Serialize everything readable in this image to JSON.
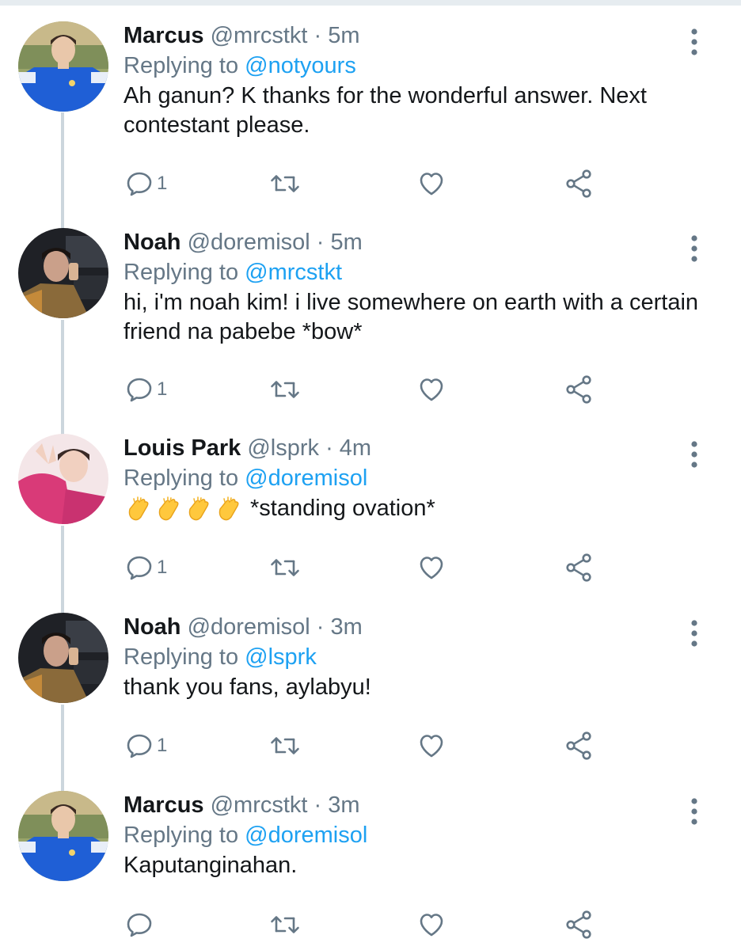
{
  "colors": {
    "accent": "#1da1f2",
    "muted": "#657786",
    "text": "#14171a",
    "line": "#ccd6dd"
  },
  "icons": {
    "reply": "reply-icon",
    "retweet": "retweet-icon",
    "like": "heart-icon",
    "share": "share-icon",
    "more": "more-vertical-icon",
    "clap": "clapping-hands-emoji"
  },
  "tweets": [
    {
      "name": "Marcus",
      "handle": "@mrcstkt",
      "sep": " · ",
      "time": "5m",
      "replying_prefix": "Replying to ",
      "replying_to": "@notyours",
      "text": "Ah ganun? K thanks for the wonderful answer. Next contestant please.",
      "reply_count": "1"
    },
    {
      "name": "Noah",
      "handle": "@doremisol",
      "sep": " · ",
      "time": "5m",
      "replying_prefix": "Replying to ",
      "replying_to": "@mrcstkt",
      "text": "hi, i'm noah kim! i live somewhere on earth with a certain friend na pabebe *bow*",
      "reply_count": "1"
    },
    {
      "name": "Louis Park",
      "handle": "@lsprk",
      "sep": " · ",
      "time": "4m",
      "replying_prefix": "Replying to ",
      "replying_to": "@doremisol",
      "text": "*standing ovation*",
      "emoji": "👏👏👏👏",
      "reply_count": "1"
    },
    {
      "name": "Noah",
      "handle": "@doremisol",
      "sep": " · ",
      "time": "3m",
      "replying_prefix": "Replying to ",
      "replying_to": "@lsprk",
      "text": "thank you fans, aylabyu!",
      "reply_count": "1"
    },
    {
      "name": "Marcus",
      "handle": "@mrcstkt",
      "sep": " · ",
      "time": "3m",
      "replying_prefix": "Replying to ",
      "replying_to": "@doremisol",
      "text": "Kaputanginahan.",
      "reply_count": ""
    }
  ]
}
